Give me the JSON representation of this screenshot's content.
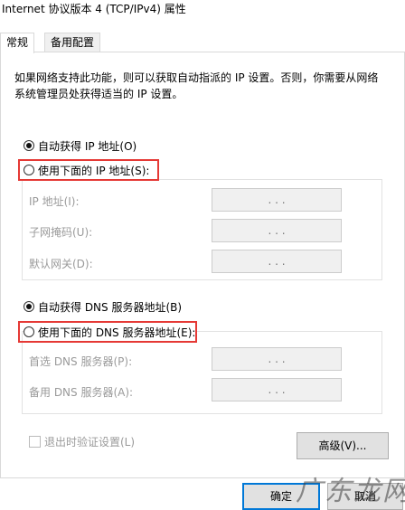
{
  "window": {
    "title": "Internet 协议版本 4 (TCP/IPv4) 属性"
  },
  "tabs": [
    {
      "label": "常规",
      "active": true
    },
    {
      "label": "备用配置",
      "active": false
    }
  ],
  "description": "如果网络支持此功能，则可以获取自动指派的 IP 设置。否则，你需要从网络系统管理员处获得适当的 IP 设置。",
  "ip_section": {
    "auto_label": "自动获得 IP 地址(O)",
    "auto_selected": true,
    "manual_label": "使用下面的 IP 地址(S):",
    "fields": [
      {
        "label": "IP 地址(I):",
        "value": ". . ."
      },
      {
        "label": "子网掩码(U):",
        "value": ". . ."
      },
      {
        "label": "默认网关(D):",
        "value": ". . ."
      }
    ]
  },
  "dns_section": {
    "auto_label": "自动获得 DNS 服务器地址(B)",
    "auto_selected": true,
    "manual_label": "使用下面的 DNS 服务器地址(E):",
    "fields": [
      {
        "label": "首选 DNS 服务器(P):",
        "value": ". . ."
      },
      {
        "label": "备用 DNS 服务器(A):",
        "value": ". . ."
      }
    ]
  },
  "validate_label": "退出时验证设置(L)",
  "buttons": {
    "advanced": "高级(V)...",
    "ok": "确定",
    "cancel": "取消"
  },
  "watermark": "广东龙网",
  "colors": {
    "highlight": "#e53935",
    "focus": "#0078d7"
  }
}
